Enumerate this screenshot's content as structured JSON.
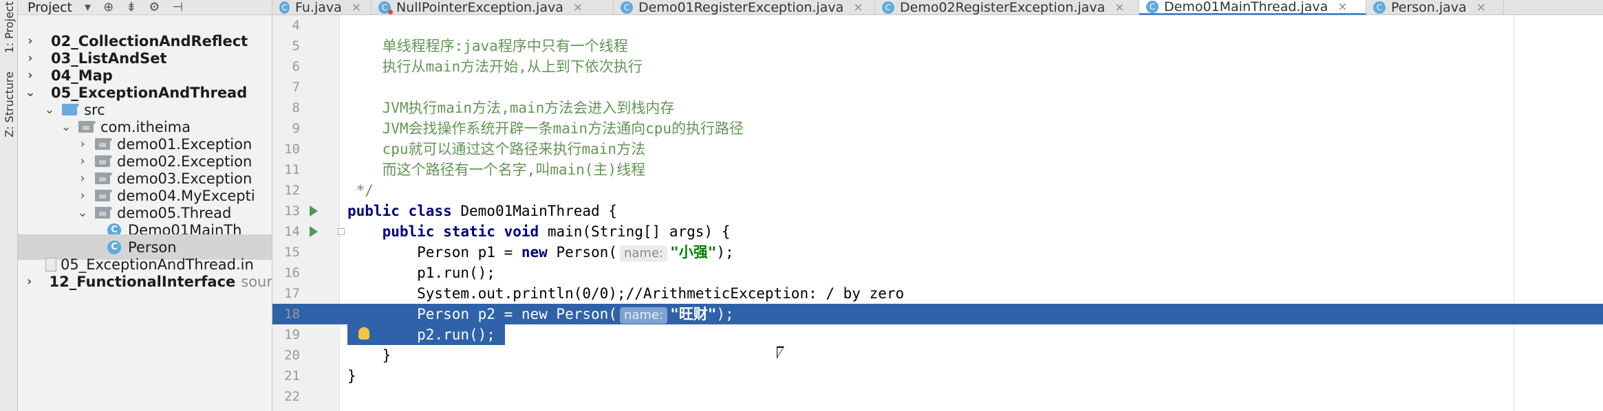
{
  "toolstrip": {
    "project_label": "1: Project",
    "structure_label": "Z: Structure"
  },
  "project_panel": {
    "title": "Project",
    "tree": [
      {
        "label": "02_CollectionAndReflect",
        "bold": true,
        "expanded": false
      },
      {
        "label": "03_ListAndSet",
        "bold": true,
        "expanded": false
      },
      {
        "label": "04_Map",
        "bold": true,
        "expanded": false
      },
      {
        "label": "05_ExceptionAndThread",
        "bold": true,
        "expanded": true
      },
      {
        "label": "src",
        "expanded": true
      },
      {
        "label": "com.itheima",
        "expanded": true
      },
      {
        "label": "demo01.Exception",
        "expanded": false
      },
      {
        "label": "demo02.Exception",
        "expanded": false
      },
      {
        "label": "demo03.Exception",
        "expanded": false
      },
      {
        "label": "demo04.MyExcepti",
        "expanded": false
      },
      {
        "label": "demo05.Thread",
        "expanded": true
      },
      {
        "label": "Demo01MainTh",
        "icon": "class-icon"
      },
      {
        "label": "Person",
        "icon": "class-icon",
        "selected": true
      },
      {
        "label": "05_ExceptionAndThread.in",
        "icon": "file-icon"
      },
      {
        "label": "12_FunctionalInterface",
        "bold": true,
        "expanded": false,
        "suffix": "sour"
      }
    ]
  },
  "tabs": [
    {
      "label": "Fu.java",
      "icon": "class-icon"
    },
    {
      "label": "NullPointerException.java",
      "icon": "exception-class-icon"
    },
    {
      "label": "Demo01RegisterException.java",
      "icon": "class-icon"
    },
    {
      "label": "Demo02RegisterException.java",
      "icon": "class-icon"
    },
    {
      "label": "Demo01MainThread.java",
      "icon": "class-icon",
      "active": true
    },
    {
      "label": "Person.java",
      "icon": "class-icon"
    }
  ],
  "editor": {
    "lines": [
      {
        "num": "4",
        "text": ""
      },
      {
        "num": "5",
        "text": "    单线程程序:java程序中只有一个线程"
      },
      {
        "num": "6",
        "text": "    执行从main方法开始,从上到下依次执行"
      },
      {
        "num": "7",
        "text": ""
      },
      {
        "num": "8",
        "text": "    JVM执行main方法,main方法会进入到栈内存"
      },
      {
        "num": "9",
        "text": "    JVM会找操作系统开辟一条main方法通向cpu的执行路径"
      },
      {
        "num": "10",
        "text": "    cpu就可以通过这个路径来执行main方法"
      },
      {
        "num": "11",
        "text": "    而这个路径有一个名字,叫main(主)线程"
      },
      {
        "num": "12",
        "text": " */"
      },
      {
        "num": "13",
        "text": "public class Demo01MainThread {"
      },
      {
        "num": "14",
        "text": "    public static void main(String[] args) {"
      },
      {
        "num": "15",
        "text": "        Person p1 = new Person(",
        "hint": "name:",
        "string": "\"小强\"",
        "tail": ");"
      },
      {
        "num": "16",
        "text": "        p1.run();"
      },
      {
        "num": "17",
        "text": "        System.out.println(0/0);//ArithmeticException: / by zero"
      },
      {
        "num": "18",
        "text": "        Person p2 = new Person(",
        "hint": "name:",
        "string": "\"旺财\"",
        "tail": ");"
      },
      {
        "num": "19",
        "text": "        p2.run();"
      },
      {
        "num": "20",
        "text": "    }"
      },
      {
        "num": "21",
        "text": "}"
      },
      {
        "num": "22",
        "text": ""
      }
    ],
    "colors": {
      "selection": "#2f62a8",
      "comment": "#629755",
      "keyword": "#000080",
      "string": "#008000"
    }
  }
}
